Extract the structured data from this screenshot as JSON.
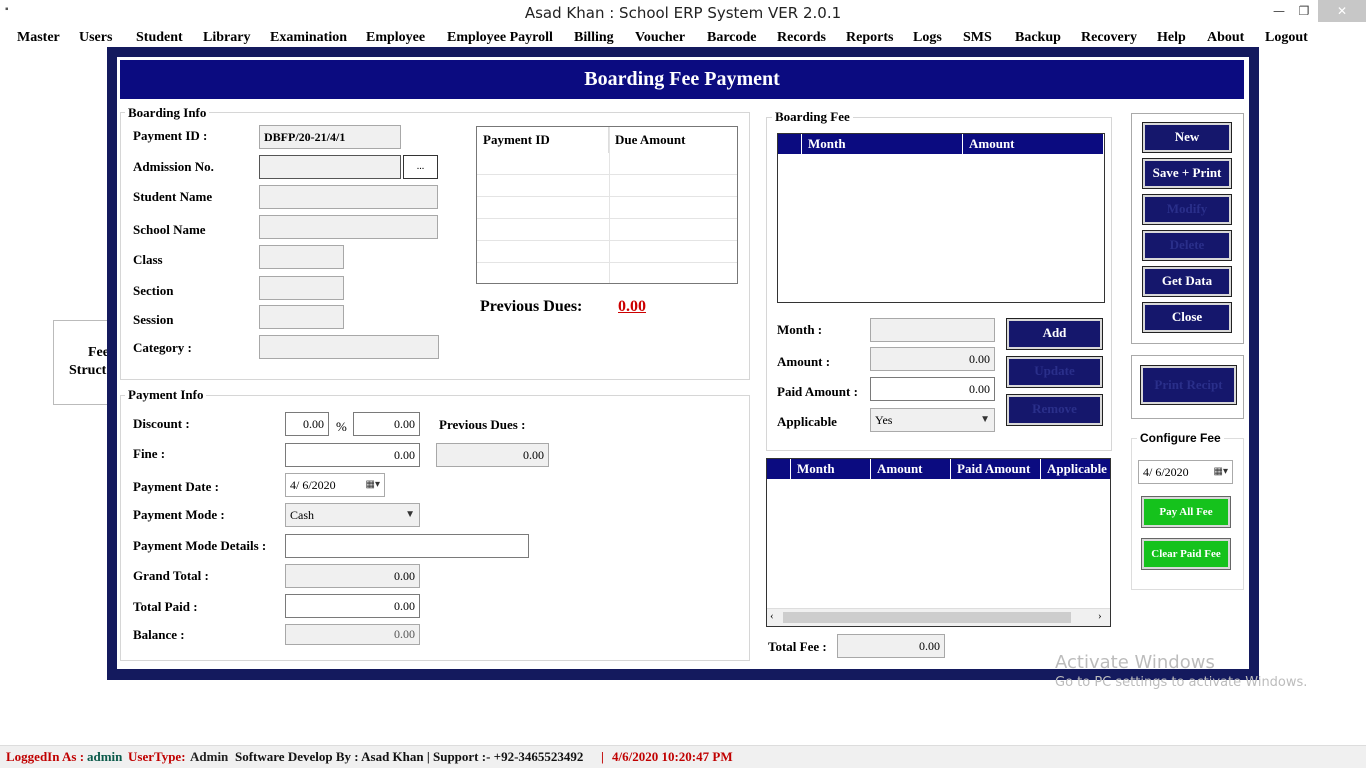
{
  "window": {
    "title": "Asad Khan : School ERP System VER 2.0.1",
    "minimize": "—",
    "restore": "❐",
    "close": "✕"
  },
  "menu": [
    "Master",
    "Users",
    "Student",
    "Library",
    "Examination",
    "Employee",
    "Employee Payroll",
    "Billing",
    "Voucher",
    "Barcode",
    "Records",
    "Reports",
    "Logs",
    "SMS",
    "Backup",
    "Recovery",
    "Help",
    "About",
    "Logout"
  ],
  "background_tile": {
    "line1": "Fee",
    "line2": "Struct"
  },
  "form": {
    "title": "Boarding Fee Payment",
    "boarding_info": {
      "title": "Boarding Info",
      "payment_id_label": "Payment ID :",
      "payment_id_value": "DBFP/20-21/4/1",
      "admission_label": "Admission No.",
      "admission_value": "",
      "browse_label": "...",
      "student_name_label": "Student Name",
      "school_name_label": "School Name",
      "class_label": "Class",
      "section_label": "Section",
      "session_label": "Session",
      "category_label": "Category :",
      "dues_grid": {
        "col1": "Payment ID",
        "col2": "Due Amount"
      },
      "previous_dues_label": "Previous Dues:",
      "previous_dues_value": "0.00"
    },
    "payment_info": {
      "title": "Payment Info",
      "discount_label": "Discount :",
      "discount_pct": "0.00",
      "pct_sign": "%",
      "discount_amt": "0.00",
      "prev_dues_label": "Previous Dues :",
      "prev_dues_value": "0.00",
      "fine_label": "Fine :",
      "fine_value": "0.00",
      "payment_date_label": "Payment Date :",
      "payment_date_value": "4/  6/2020",
      "payment_mode_label": "Payment Mode :",
      "payment_mode_value": "Cash",
      "mode_details_label": "Payment Mode Details :",
      "mode_details_value": "",
      "grand_total_label": "Grand Total :",
      "grand_total_value": "0.00",
      "total_paid_label": "Total Paid :",
      "total_paid_value": "0.00",
      "balance_label": "Balance :",
      "balance_value": "0.00"
    },
    "boarding_fee": {
      "title": "Boarding Fee",
      "grid": {
        "col1": "Month",
        "col2": "Amount"
      },
      "month_label": "Month :",
      "month_value": "",
      "amount_label": "Amount :",
      "amount_value": "0.00",
      "paid_amount_label": "Paid Amount :",
      "paid_amount_value": "0.00",
      "applicable_label": "Applicable",
      "applicable_value": "Yes",
      "add": "Add",
      "update": "Update",
      "remove": "Remove"
    },
    "fee_list": {
      "cols": [
        "Month",
        "Amount",
        "Paid Amount",
        "Applicable"
      ],
      "total_label": "Total Fee :",
      "total_value": "0.00"
    },
    "actions": {
      "new": "New",
      "save_print": "Save + Print",
      "modify": "Modify",
      "delete": "Delete",
      "get_data": "Get Data",
      "close": "Close",
      "print_receipt": "Print Recipt"
    },
    "configure": {
      "title": "Configure Fee",
      "date_value": "4/  6/2020",
      "pay_all": "Pay All Fee",
      "clear_paid": "Clear Paid Fee"
    }
  },
  "watermark": {
    "line1": "Activate Windows",
    "line2": "Go to PC settings to activate Windows."
  },
  "status": {
    "logged_in_label": "LoggedIn As :",
    "user": "admin",
    "usertype_label": "UserType:",
    "usertype": "Admin",
    "developer": "Software Develop By : Asad Khan | Support :-  +92-3465523492",
    "separator": "|",
    "datetime": "4/6/2020 10:20:47 PM"
  },
  "colors": {
    "navy": "#0b0b80",
    "frame": "#141a5e",
    "green": "#15c21c",
    "red": "#cc0000",
    "teal": "#0a5a4a"
  }
}
